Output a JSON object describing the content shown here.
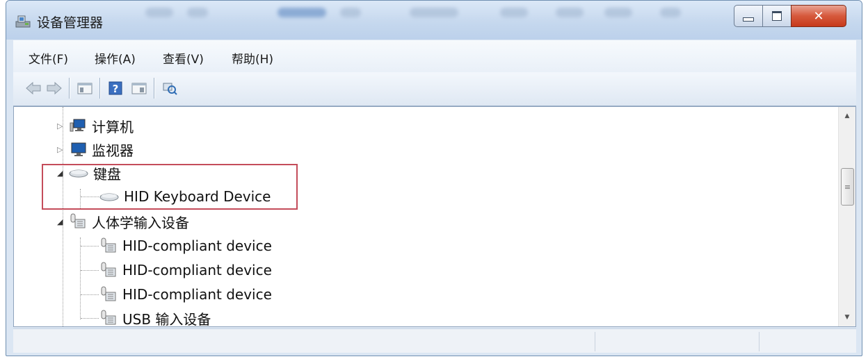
{
  "window": {
    "title": "设备管理器"
  },
  "menu": {
    "items": [
      "文件(F)",
      "操作(A)",
      "查看(V)",
      "帮助(H)"
    ]
  },
  "toolbar": {
    "icons": [
      "back-arrow-icon",
      "forward-arrow-icon",
      "show-hide-console-tree-icon",
      "help-icon",
      "properties-icon",
      "scan-hardware-changes-icon"
    ]
  },
  "tree": {
    "nodes": [
      {
        "label": "计算机",
        "expanded": false,
        "icon": "computer-icon"
      },
      {
        "label": "监视器",
        "expanded": false,
        "icon": "monitor-icon"
      },
      {
        "label": "键盘",
        "expanded": true,
        "icon": "keyboard-icon"
      },
      {
        "label": "HID Keyboard Device",
        "icon": "keyboard-icon"
      },
      {
        "label": "人体学输入设备",
        "expanded": true,
        "icon": "hid-device-icon"
      },
      {
        "label": "HID-compliant device",
        "icon": "hid-device-icon"
      },
      {
        "label": "HID-compliant device",
        "icon": "hid-device-icon"
      },
      {
        "label": "HID-compliant device",
        "icon": "hid-device-icon"
      },
      {
        "label": "USB 输入设备",
        "icon": "hid-device-icon"
      }
    ]
  },
  "colors": {
    "highlight_box": "#c44c5a",
    "close_button": "#c7391b",
    "titlebar": "#c6d8ee"
  }
}
